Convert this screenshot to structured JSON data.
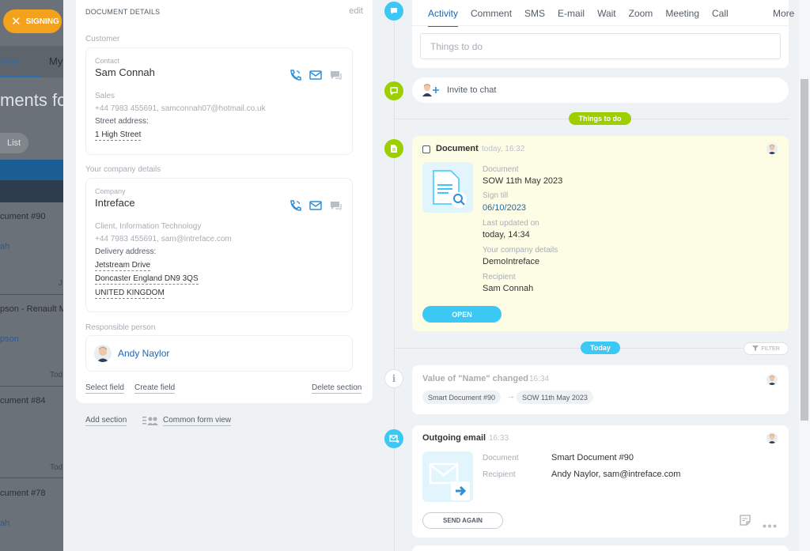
{
  "background": {
    "signing_label": "SIGNING",
    "tab_active": "ents",
    "tab_other": "My",
    "page_title": "ments for",
    "list_label": "List",
    "rows": [
      {
        "title": "cument #90",
        "link": "ah"
      },
      {
        "title": "pson - Renault M",
        "link": "pson"
      },
      {
        "title": "cument #84",
        "link": ""
      },
      {
        "title": "cument #78",
        "link": "ah"
      }
    ],
    "muted_j": "J",
    "muted_tod": "Tod"
  },
  "details": {
    "section_title": "DOCUMENT DETAILS",
    "edit_label": "edit",
    "customer_label": "Customer",
    "contact": {
      "type_label": "Contact",
      "name": "Sam Connah",
      "role": "Sales",
      "contact_line": "+44 7983 455691, samconnah07@hotmail.co.uk",
      "address_label": "Street address:",
      "address": "1 High Street"
    },
    "company_label": "Your company details",
    "company": {
      "type_label": "Company",
      "name": "Intreface",
      "industry": "Client, Information Technology",
      "contact_line": "+44 7983 455691, sam@intreface.com",
      "address_label": "Delivery address:",
      "address_lines": [
        "Jetstream Drive",
        "Doncaster England DN9 3QS",
        "UNITED KINGDOM"
      ]
    },
    "responsible_label": "Responsible person",
    "responsible_name": "Andy Naylor",
    "select_field": "Select field",
    "create_field": "Create field",
    "delete_section": "Delete section"
  },
  "below": {
    "add_section": "Add section",
    "common_form_view": "Common form view"
  },
  "activity": {
    "tabs": [
      "Activity",
      "Comment",
      "SMS",
      "E-mail",
      "Wait",
      "Zoom",
      "Meeting",
      "Call"
    ],
    "more_label": "More",
    "todo_placeholder": "Things to do"
  },
  "invite": {
    "label": "Invite to chat"
  },
  "things_to_do_badge": "Things to do",
  "document_card": {
    "title": "Document",
    "time": "today, 16:32",
    "fields": [
      {
        "label": "Document",
        "value": "SOW 11th May 2023"
      },
      {
        "label": "Sign till",
        "value": "06/10/2023"
      },
      {
        "label": "Last updated on",
        "value": "today, 14:34"
      },
      {
        "label": "Your company details",
        "value": "DemoIntreface"
      },
      {
        "label": "Recipient",
        "value": "Sam Connah"
      }
    ],
    "open_label": "OPEN"
  },
  "today_badge": "Today",
  "filter_label": "FILTER",
  "change_card": {
    "title": "Value of \"Name\" changed",
    "time": "16:34",
    "from": "Smart Document #90",
    "to": "SOW 11th May 2023"
  },
  "email_card": {
    "title": "Outgoing email",
    "time": "16:33",
    "document_label": "Document",
    "document_value": "Smart Document #90",
    "recipient_label": "Recipient",
    "recipient_value": "Andy Naylor, sam@intreface.com",
    "send_again_label": "SEND AGAIN"
  },
  "colors": {
    "accent_blue": "#2067b0",
    "timeline_blue": "#3bc8f5",
    "timeline_green": "#9dcf00",
    "signing_orange": "#f4a11c",
    "doc_card_bg": "#fdfde6"
  }
}
